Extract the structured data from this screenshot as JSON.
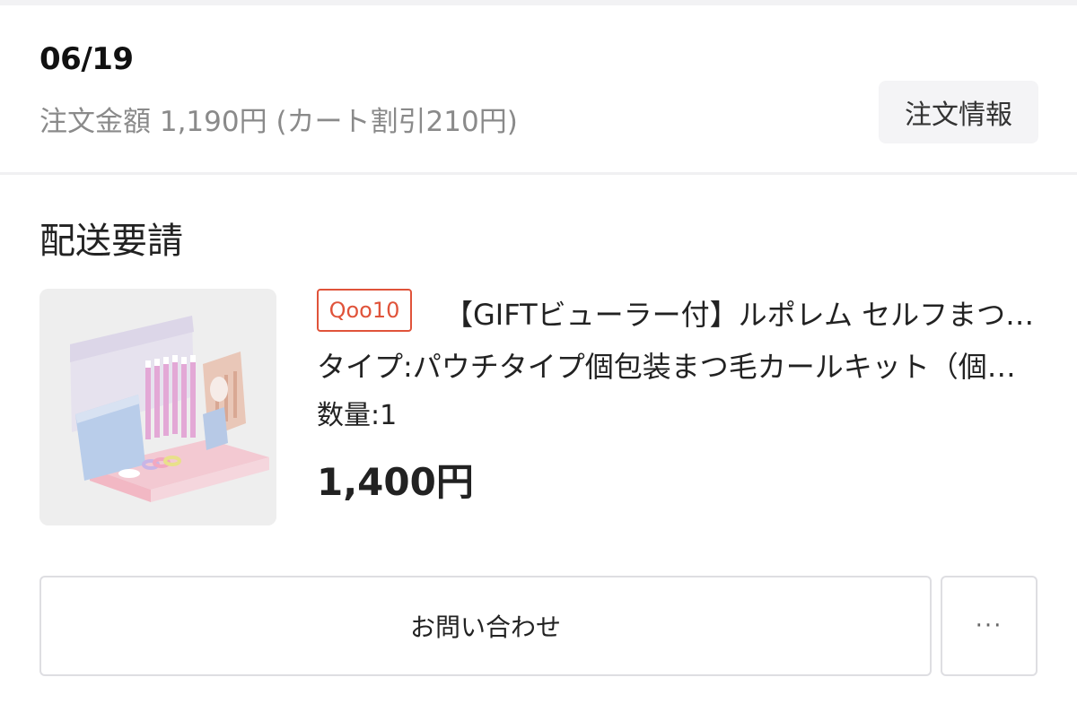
{
  "order": {
    "date": "06/19",
    "amount_text": "注文金額 1,190円 (カート割引210円)",
    "info_button_label": "注文情報"
  },
  "delivery": {
    "section_title": "配送要請",
    "item": {
      "shop_badge": "Qoo10",
      "title": "【GIFTビューラー付】ルポレム セルフまつ毛カールキット",
      "option": "タイプ:パウチタイプ個包装まつ毛カールキット（個包装）",
      "quantity": "数量:1",
      "price": "1,400円",
      "image_label": "product-photo-lash-lift-kit-display"
    }
  },
  "actions": {
    "contact_label": "お問い合わせ",
    "more_label": "···"
  },
  "colors": {
    "badge": "#e0533a",
    "muted_text": "#8a8a8a",
    "button_bg": "#f4f4f6",
    "border": "#dedee2"
  }
}
